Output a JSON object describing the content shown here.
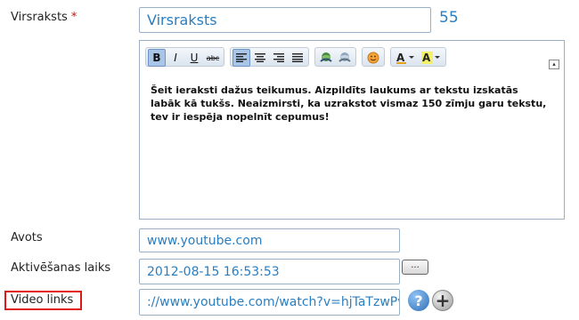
{
  "form": {
    "title_label": "Virsraksts",
    "required_mark": "*",
    "title_value": "Virsraksts",
    "title_counter": "55",
    "editor": {
      "toolbar": {
        "bold": "B",
        "italic": "I",
        "underline": "U",
        "strike": "abc"
      },
      "content": "Šeit ieraksti dažus teikumus. Aizpildīts laukums ar tekstu izskatās labāk kā tukšs. Neaizmirsti, ka uzrakstot vismaz 150 zīmju garu tekstu, tev ir iespēja nopelnīt cepumus!"
    },
    "source_label": "Avots",
    "source_value": "www.youtube.com",
    "activation_label": "Aktivēšanas laiks",
    "activation_value": "2012-08-15 16:53:53",
    "browse_label": "...",
    "video_label": "Video links",
    "video_value": "://www.youtube.com/watch?v=hjTaTzwPvPE",
    "help_label": "?",
    "add_label": "+"
  },
  "colors": {
    "accent": "#2a7ec0",
    "highlight": "#e01818"
  }
}
